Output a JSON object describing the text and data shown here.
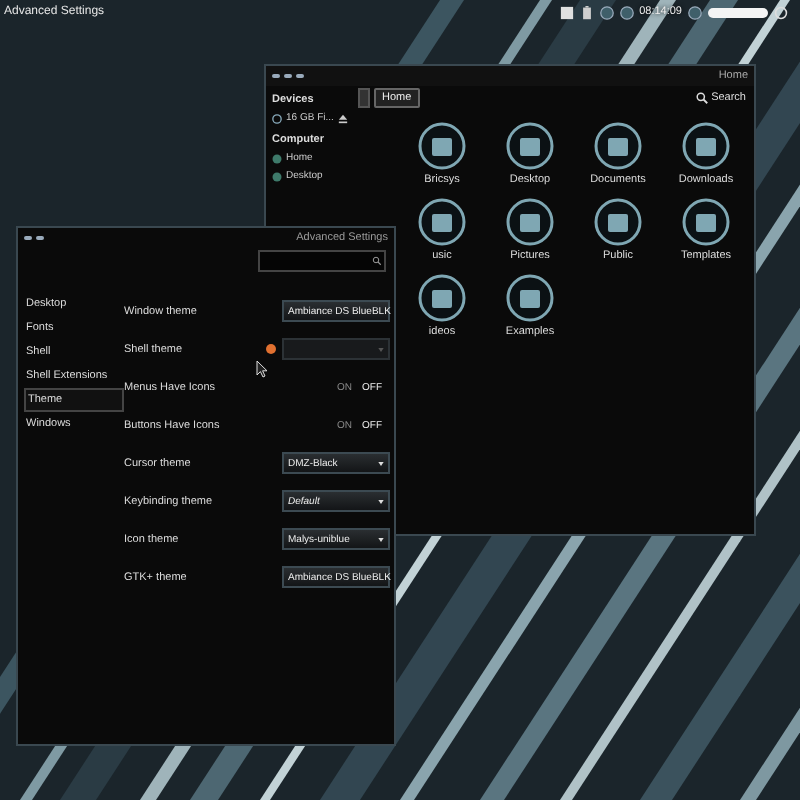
{
  "top_bar": {
    "app_title": "Advanced Settings",
    "clock": "08:14:09"
  },
  "file_manager": {
    "title": "Home",
    "path_button": "Home",
    "search": "Search",
    "sidebar": [
      {
        "kind": "heading",
        "label": "Devices"
      },
      {
        "kind": "device",
        "label": "16 GB Fi..."
      },
      {
        "kind": "heading",
        "label": "Computer"
      },
      {
        "kind": "place",
        "label": "Home"
      },
      {
        "kind": "place",
        "label": "Desktop"
      }
    ],
    "files": [
      {
        "label": "Bricsys"
      },
      {
        "label": "Desktop"
      },
      {
        "label": "Documents"
      },
      {
        "label": "Downloads"
      },
      {
        "label": "usic"
      },
      {
        "label": "Pictures"
      },
      {
        "label": "Public"
      },
      {
        "label": "Templates"
      },
      {
        "label": "ideos"
      },
      {
        "label": "Examples"
      }
    ]
  },
  "advanced_settings": {
    "title": "Advanced Settings",
    "sidebar": [
      {
        "label": "Desktop",
        "selected": false
      },
      {
        "label": "Fonts",
        "selected": false
      },
      {
        "label": "Shell",
        "selected": false
      },
      {
        "label": "Shell Extensions",
        "selected": false
      },
      {
        "label": "Theme",
        "selected": true
      },
      {
        "label": "Windows",
        "selected": false
      }
    ],
    "settings": [
      {
        "kind": "combo",
        "label": "Window theme",
        "value": "Ambiance DS BlueBLK"
      },
      {
        "kind": "combo",
        "label": "Shell theme",
        "warning": true,
        "disabled": true
      },
      {
        "kind": "switch",
        "label": "Menus Have Icons",
        "on_label": "ON",
        "off_label": "OFF",
        "on": false
      },
      {
        "kind": "switch",
        "label": "Buttons Have Icons",
        "on_label": "ON",
        "off_label": "OFF",
        "on": false
      },
      {
        "kind": "combo",
        "label": "Cursor theme",
        "value": "DMZ-Black"
      },
      {
        "kind": "combo",
        "label": "Keybinding theme",
        "value": "Default",
        "italic": true
      },
      {
        "kind": "combo",
        "label": "Icon theme",
        "value": "Malys-uniblue"
      },
      {
        "kind": "combo",
        "label": "GTK+ theme",
        "value": "Ambiance DS BlueBLK"
      }
    ]
  }
}
